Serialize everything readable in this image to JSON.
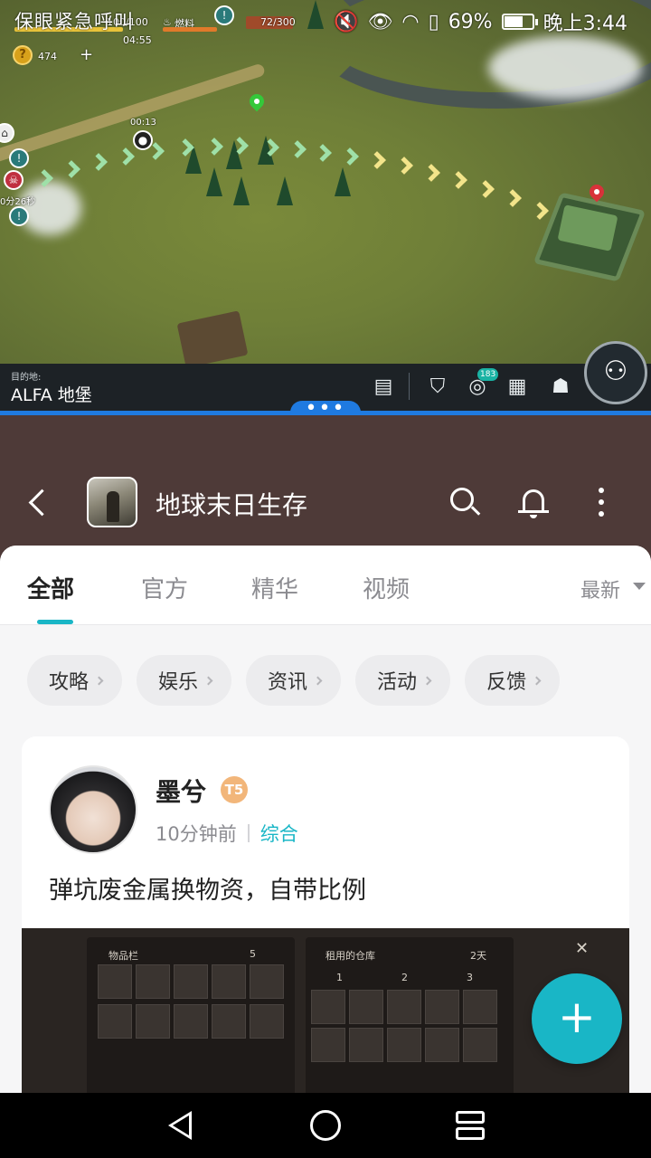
{
  "status_bar": {
    "left_text": "保眼紧急呼叫",
    "battery": "69%",
    "battery_level": 0.69,
    "time": "晚上3:44"
  },
  "game": {
    "hud": {
      "stat1": "100/100",
      "fuel_label": "燃料",
      "fuel_value": "72/300",
      "timer": "04:55",
      "coins": "474",
      "add": "+",
      "marker_time": "00:13",
      "side_timer": "0分26秒"
    },
    "destination_label": "目的地:",
    "destination_name": "ALFA 地堡",
    "toolbar": {
      "chat_icon": "chat-icon",
      "shield_icon": "shield-icon",
      "coins_icon": "coins-icon",
      "coins_badge": "183",
      "map_icon": "map-icon",
      "backpack_icon": "backpack-icon",
      "team_icon": "team-icon"
    },
    "split_handle": "•••"
  },
  "header": {
    "title": "地球末日生存"
  },
  "tabs": [
    {
      "label": "全部",
      "active": true
    },
    {
      "label": "官方",
      "active": false
    },
    {
      "label": "精华",
      "active": false
    },
    {
      "label": "视频",
      "active": false
    }
  ],
  "sort": {
    "label": "最新"
  },
  "chips": [
    "攻略",
    "娱乐",
    "资讯",
    "活动",
    "反馈"
  ],
  "post": {
    "author": "墨兮",
    "level": "T5",
    "time": "10分钟前",
    "category": "综合",
    "title": "弹坑废金属换物资，自带比例",
    "image": {
      "left_title": "物品栏",
      "right_title": "租用的仓库",
      "left_count": "5",
      "right_days": "2天",
      "pages": [
        "1",
        "2",
        "3"
      ]
    }
  },
  "fab": {
    "label": "+"
  },
  "colors": {
    "accent": "#19b6c6",
    "header_bg": "#4e3a38",
    "split_blue": "#1f7ae0"
  }
}
